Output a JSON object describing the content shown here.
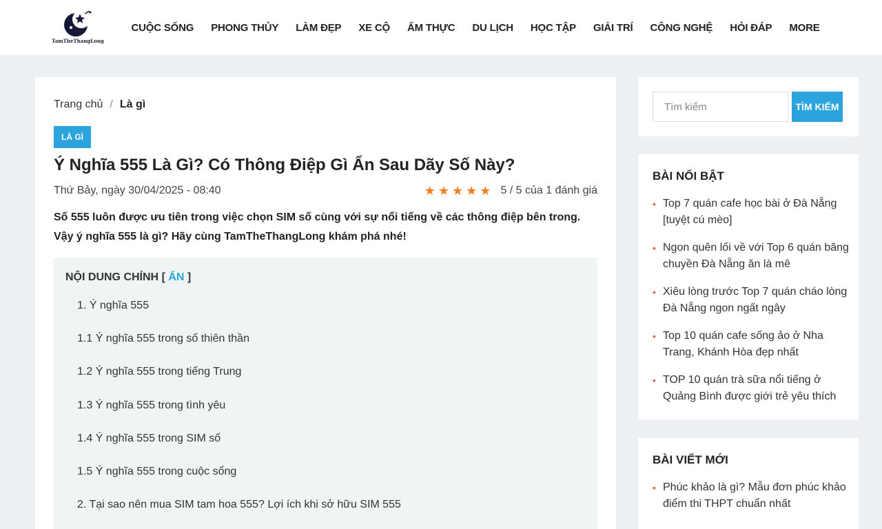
{
  "brand": {
    "logo_text": "TamTheThangLong"
  },
  "nav": {
    "items": [
      "CUỘC SỐNG",
      "PHONG THỦY",
      "LÀM ĐẸP",
      "XE CỘ",
      "ẨM THỰC",
      "DU LỊCH",
      "HỌC TẬP",
      "GIẢI TRÍ",
      "CÔNG NGHỆ",
      "HỎI ĐÁP",
      "MORE"
    ]
  },
  "breadcrumb": {
    "home": "Trang chủ",
    "separator": "/",
    "current": "Là gì"
  },
  "article": {
    "category": "LÀ GÌ",
    "title": "Ý Nghĩa 555 Là Gì? Có Thông Điệp Gì Ẩn Sau Dãy Số Này?",
    "date": "Thứ Bảy, ngày 30/04/2025 - 08:40",
    "rating_text": "5 / 5 của 1 đánh giá",
    "rating_value": 5,
    "sapo": "Số 555 luôn được ưu tiên trong việc chọn SIM số cùng với sự nổi tiếng về các thông điệp bên trong. Vậy ý nghĩa 555 là gì? Hãy cùng TamTheThangLong khám phá nhé!"
  },
  "toc": {
    "title": "NỘI DUNG CHÍNH",
    "bracket_open": "[",
    "toggle": "ẨN",
    "bracket_close": "]",
    "items": [
      "1. Ý nghĩa 555",
      "1.1 Ý nghĩa 555 trong số thiên thần",
      "1.2 Ý nghĩa 555 trong tiếng Trung",
      "1.3 Ý nghĩa 555 trong tình yêu",
      "1.4 Ý nghĩa 555 trong SIM số",
      "1.5 Ý nghĩa 555 trong cuộc sống",
      "2. Tại sao nên mua SIM tam hoa 555? Lợi ích khi sở hữu SIM 555"
    ]
  },
  "search": {
    "placeholder": "Tìm kiếm",
    "button": "TÌM KIẾM"
  },
  "featured": {
    "title": "BÀI NỔI BẬT",
    "items": [
      "Top 7 quán cafe học bài ở Đà Nẵng [tuyệt cú mèo]",
      "Ngon quên lối về với Top 6 quán băng chuyền Đà Nẵng ăn là mê",
      "Xiêu lòng trước Top 7 quán cháo lòng Đà Nẵng ngon ngất ngây",
      "Top 10 quán cafe sống ảo ở Nha Trang, Khánh Hòa đẹp nhất",
      "TOP 10 quán trà sữa nổi tiếng ở Quảng Bình được giới trẻ yêu thích"
    ]
  },
  "latest": {
    "title": "BÀI VIẾT MỚI",
    "items": [
      "Phúc khảo là gì? Mẫu đơn phúc khảo điểm thi THPT chuẩn nhất"
    ]
  },
  "colors": {
    "accent": "#2ba4dd",
    "star": "#f27d1b",
    "bullet": "#e0604b",
    "background": "#ecf0f2"
  },
  "icons": {
    "logo": "moon-star-logo-icon",
    "star": "star-icon"
  }
}
